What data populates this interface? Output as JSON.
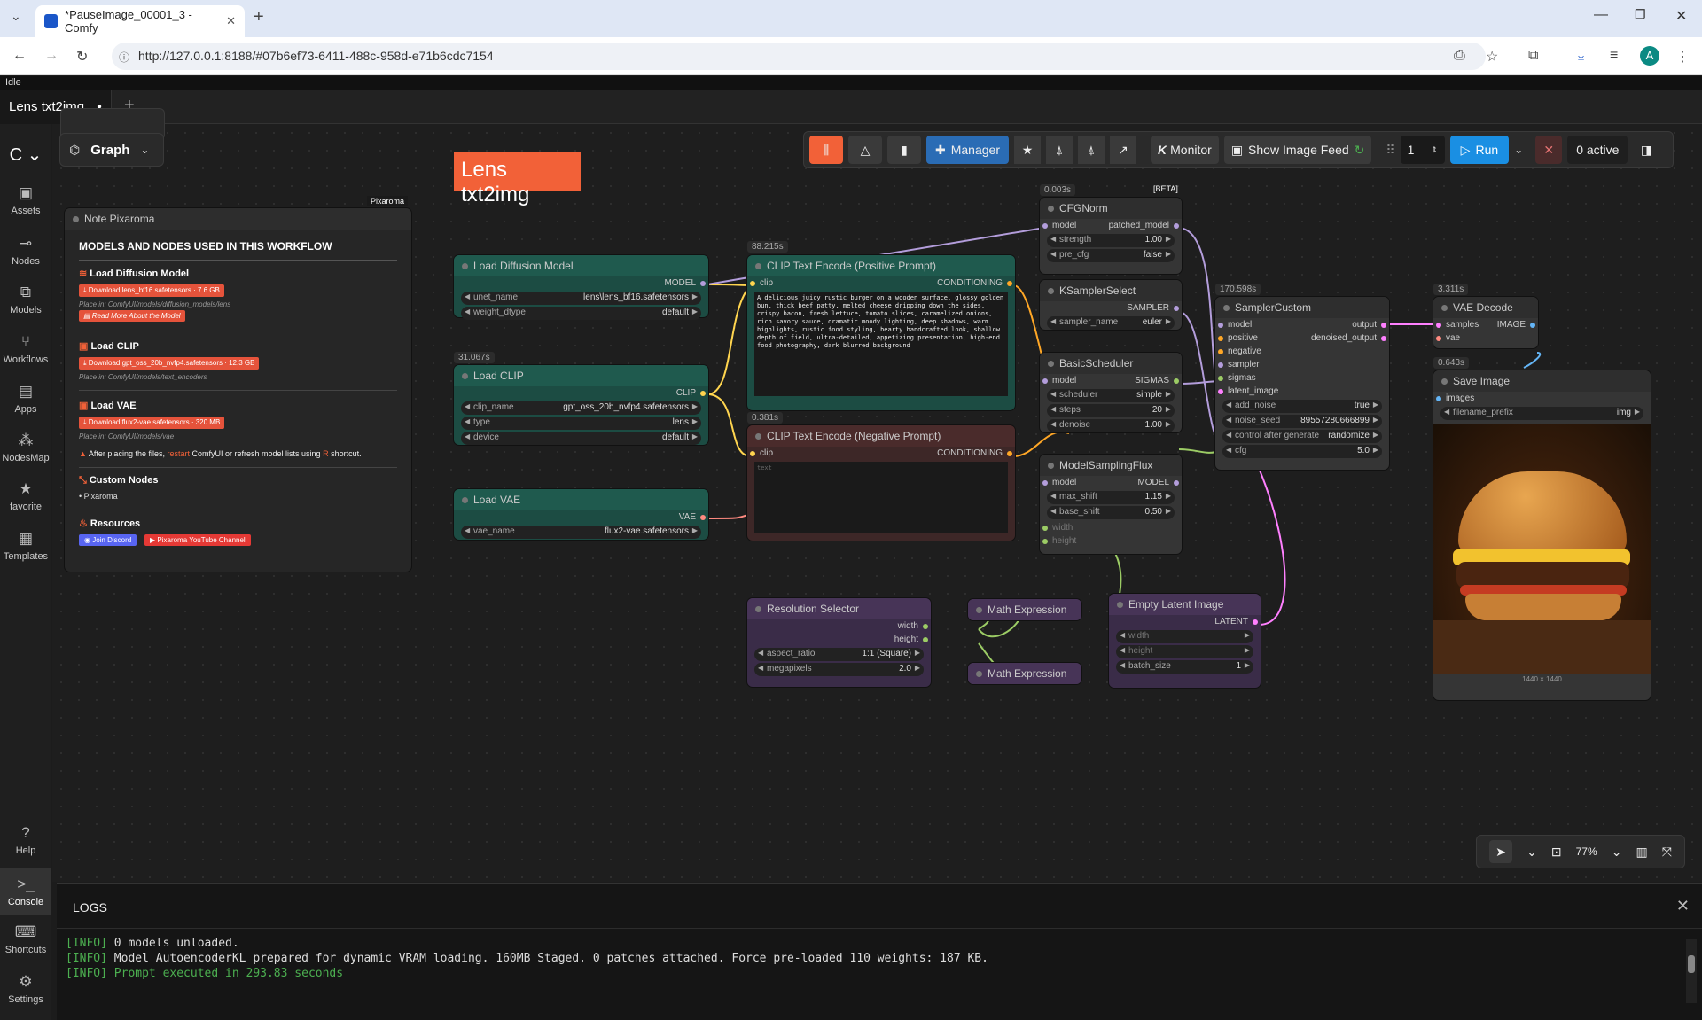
{
  "browser": {
    "tab_title": "*PauseImage_00001_3 - Comfy",
    "url": "http://127.0.0.1:8188/#07b6ef73-6411-488c-958d-e71b6cdc7154",
    "profile_initial": "A"
  },
  "status": "Idle",
  "workflow_tab": {
    "label": "Lens txt2img",
    "dot": "●",
    "add": "+"
  },
  "sidebar": {
    "items": [
      {
        "label": "Assets",
        "icon": "image-icon"
      },
      {
        "label": "Nodes",
        "icon": "nodes-icon"
      },
      {
        "label": "Models",
        "icon": "models-icon"
      },
      {
        "label": "Workflows",
        "icon": "workflows-icon"
      },
      {
        "label": "Apps",
        "icon": "apps-icon"
      },
      {
        "label": "NodesMap",
        "icon": "nodesmap-icon"
      },
      {
        "label": "favorite",
        "icon": "star-icon"
      },
      {
        "label": "Templates",
        "icon": "templates-icon"
      }
    ],
    "bottom": [
      {
        "label": "Help"
      },
      {
        "label": "Console"
      },
      {
        "label": "Shortcuts"
      },
      {
        "label": "Settings"
      }
    ]
  },
  "graph_button": "Graph",
  "toolbar": {
    "manager": "Manager",
    "monitor": "Monitor",
    "show_image_feed": "Show Image Feed",
    "batch": "1",
    "run": "Run",
    "active": "0 active",
    "zoom": "77%"
  },
  "canvas_title": "Lens txt2img",
  "note": {
    "badge": "Pixaroma",
    "title": "Note Pixaroma",
    "heading": "MODELS AND NODES USED IN THIS WORKFLOW",
    "s1": "Load Diffusion Model",
    "s1_btn": "Download lens_bf16.safetensors",
    "s1_size": "· 7.6 GB",
    "s1_place": "Place in: ComfyUI/models/diffusion_models/lens",
    "s1_more": "Read More About the Model",
    "s2": "Load CLIP",
    "s2_btn": "Download gpt_oss_20b_nvfp4.safetensors",
    "s2_size": "· 12.3 GB",
    "s2_place": "Place in: ComfyUI/models/text_encoders",
    "s3": "Load VAE",
    "s3_btn": "Download flux2-vae.safetensors",
    "s3_size": "· 320 MB",
    "s3_place": "Place in: ComfyUI/models/vae",
    "warn_a": "After placing the files,",
    "warn_restart": "restart",
    "warn_b": "ComfyUI or refresh model lists using",
    "warn_key": "R",
    "warn_c": "shortcut.",
    "custom": "Custom Nodes",
    "custom_item": "Pixaroma",
    "res": "Resources",
    "discord": "Join Discord",
    "youtube": "Pixaroma YouTube Channel"
  },
  "nodes": {
    "ldm": {
      "title": "Load Diffusion Model",
      "out": "MODEL",
      "w1": "unet_name",
      "v1": "lens\\lens_bf16.safetensors",
      "w2": "weight_dtype",
      "v2": "default"
    },
    "lclip": {
      "time": "31.067s",
      "title": "Load CLIP",
      "out": "CLIP",
      "w1": "clip_name",
      "v1": "gpt_oss_20b_nvfp4.safetensors",
      "w2": "type",
      "v2": "lens",
      "w3": "device",
      "v3": "default"
    },
    "lvae": {
      "title": "Load VAE",
      "out": "VAE",
      "w1": "vae_name",
      "v1": "flux2-vae.safetensors"
    },
    "pos": {
      "time": "88.215s",
      "title": "CLIP Text Encode (Positive Prompt)",
      "in": "clip",
      "out": "CONDITIONING",
      "text": "A delicious juicy rustic burger on a wooden surface, glossy golden bun, thick beef patty, melted cheese dripping down the sides, crispy bacon, fresh lettuce, tomato slices, caramelized onions, rich savory sauce, dramatic moody lighting, deep shadows, warm highlights, rustic food styling, hearty handcrafted look, shallow depth of field, ultra-detailed, appetizing presentation, high-end food photography, dark blurred background"
    },
    "neg": {
      "time": "0.381s",
      "title": "CLIP Text Encode (Negative Prompt)",
      "in": "clip",
      "out": "CONDITIONING",
      "placeholder": "text"
    },
    "cfgnorm": {
      "time": "0.003s",
      "beta": "[BETA]",
      "title": "CFGNorm",
      "in": "model",
      "out": "patched_model",
      "w1": "strength",
      "v1": "1.00",
      "w2": "pre_cfg",
      "v2": "false"
    },
    "ksel": {
      "title": "KSamplerSelect",
      "out": "SAMPLER",
      "w1": "sampler_name",
      "v1": "euler"
    },
    "bsched": {
      "title": "BasicScheduler",
      "in": "model",
      "out": "SIGMAS",
      "w1": "scheduler",
      "v1": "simple",
      "w2": "steps",
      "v2": "20",
      "w3": "denoise",
      "v3": "1.00"
    },
    "msf": {
      "title": "ModelSamplingFlux",
      "in": "model",
      "out": "MODEL",
      "w1": "max_shift",
      "v1": "1.15",
      "w2": "base_shift",
      "v2": "0.50",
      "i1": "width",
      "i2": "height"
    },
    "sc": {
      "time": "170.598s",
      "title": "SamplerCustom",
      "in1": "model",
      "in2": "positive",
      "in3": "negative",
      "in4": "sampler",
      "in5": "sigmas",
      "in6": "latent_image",
      "out1": "output",
      "out2": "denoised_output",
      "w1": "add_noise",
      "v1": "true",
      "w2": "noise_seed",
      "v2": "89557280666899",
      "w3": "control after generate",
      "v3": "randomize",
      "w4": "cfg",
      "v4": "5.0"
    },
    "vaed": {
      "time": "3.311s",
      "title": "VAE Decode",
      "in1": "samples",
      "in2": "vae",
      "out": "IMAGE"
    },
    "save": {
      "time": "0.643s",
      "title": "Save Image",
      "in": "images",
      "w1": "filename_prefix",
      "v1": "img",
      "dims": "1440 × 1440"
    },
    "res": {
      "title": "Resolution Selector",
      "o1": "width",
      "o2": "height",
      "w1": "aspect_ratio",
      "v1": "1:1 (Square)",
      "w2": "megapixels",
      "v2": "2.0"
    },
    "me1": {
      "title": "Math Expression"
    },
    "me2": {
      "title": "Math Expression"
    },
    "ela": {
      "title": "Empty Latent Image",
      "out": "LATENT",
      "i1": "width",
      "i2": "height",
      "w1": "batch_size",
      "v1": "1"
    }
  },
  "logs": {
    "title": "LOGS",
    "lines": [
      {
        "tag": "[INFO]",
        "text": " 0 models unloaded."
      },
      {
        "tag": "[INFO]",
        "text": " Model AutoencoderKL prepared for dynamic VRAM loading. 160MB Staged. 0 patches attached. Force pre-loaded 110 weights: 187 KB."
      },
      {
        "tag": "[INFO]",
        "text": " Prompt executed in 293.83 seconds"
      }
    ]
  },
  "colors": {
    "accent": "#ff5a36",
    "run": "#1a8fe3",
    "manager": "#2a6cb5",
    "link_model": "#b39ddb",
    "link_clip": "#ffd54f",
    "link_cond": "#ffa726",
    "link_latent": "#ff80ff"
  }
}
